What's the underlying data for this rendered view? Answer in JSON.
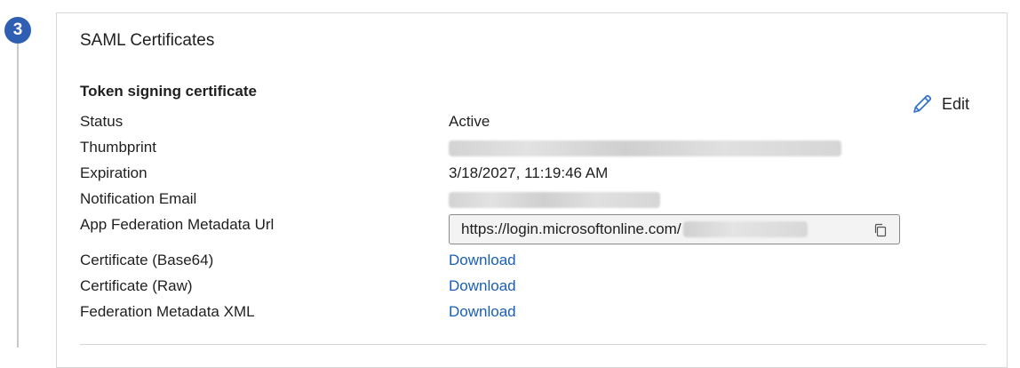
{
  "step": {
    "number": "3"
  },
  "card": {
    "title": "SAML Certificates",
    "edit_label": "Edit"
  },
  "token_signing": {
    "section_title": "Token signing certificate",
    "rows": [
      {
        "label": "Status",
        "value": "Active"
      },
      {
        "label": "Thumbprint",
        "value": ""
      },
      {
        "label": "Expiration",
        "value": "3/18/2027, 11:19:46 AM"
      },
      {
        "label": "Notification Email",
        "value": ""
      },
      {
        "label": "App Federation Metadata Url",
        "value": "https://login.microsoftonline.com/"
      },
      {
        "label": "Certificate (Base64)",
        "value": "Download"
      },
      {
        "label": "Certificate (Raw)",
        "value": "Download"
      },
      {
        "label": "Federation Metadata XML",
        "value": "Download"
      }
    ]
  },
  "colors": {
    "accent": "#2f5fb2",
    "link": "#1a5fb4",
    "border": "#d6d6d6"
  },
  "icons": {
    "edit": "pencil-icon",
    "copy": "copy-icon"
  }
}
